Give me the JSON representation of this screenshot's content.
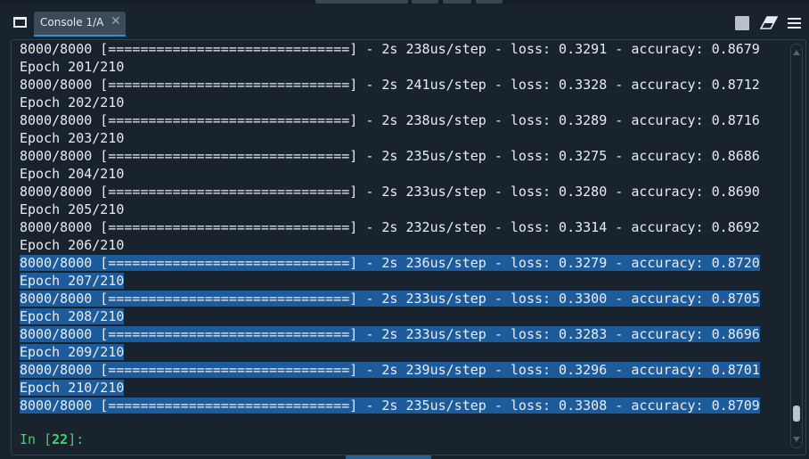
{
  "tab": {
    "label": "Console 1/A",
    "close_glyph": "✕"
  },
  "toolbar": {
    "icons": [
      "window-icon",
      "stop-icon",
      "eraser-icon",
      "hamburger-menu-icon"
    ]
  },
  "output_lines": [
    {
      "text": "8000/8000 [==============================] - 2s 238us/step - loss: 0.3291 - accuracy: 0.8679",
      "selected": false
    },
    {
      "text": "Epoch 201/210",
      "selected": false
    },
    {
      "text": "8000/8000 [==============================] - 2s 241us/step - loss: 0.3328 - accuracy: 0.8712",
      "selected": false
    },
    {
      "text": "Epoch 202/210",
      "selected": false
    },
    {
      "text": "8000/8000 [==============================] - 2s 238us/step - loss: 0.3289 - accuracy: 0.8716",
      "selected": false
    },
    {
      "text": "Epoch 203/210",
      "selected": false
    },
    {
      "text": "8000/8000 [==============================] - 2s 235us/step - loss: 0.3275 - accuracy: 0.8686",
      "selected": false
    },
    {
      "text": "Epoch 204/210",
      "selected": false
    },
    {
      "text": "8000/8000 [==============================] - 2s 233us/step - loss: 0.3280 - accuracy: 0.8690",
      "selected": false
    },
    {
      "text": "Epoch 205/210",
      "selected": false
    },
    {
      "text": "8000/8000 [==============================] - 2s 232us/step - loss: 0.3314 - accuracy: 0.8692",
      "selected": false
    },
    {
      "text": "Epoch 206/210",
      "selected": false
    },
    {
      "text": "8000/8000 [==============================] - 2s 236us/step - loss: 0.3279 - accuracy: 0.8720",
      "selected": true
    },
    {
      "text": "Epoch 207/210",
      "selected": true
    },
    {
      "text": "8000/8000 [==============================] - 2s 233us/step - loss: 0.3300 - accuracy: 0.8705",
      "selected": true
    },
    {
      "text": "Epoch 208/210",
      "selected": true
    },
    {
      "text": "8000/8000 [==============================] - 2s 233us/step - loss: 0.3283 - accuracy: 0.8696",
      "selected": true
    },
    {
      "text": "Epoch 209/210",
      "selected": true
    },
    {
      "text": "8000/8000 [==============================] - 2s 239us/step - loss: 0.3296 - accuracy: 0.8701",
      "selected": true
    },
    {
      "text": "Epoch 210/210",
      "selected": true
    },
    {
      "text": "8000/8000 [==============================] - 2s 235us/step - loss: 0.3308 - accuracy: 0.8709",
      "selected": true
    }
  ],
  "prompt": {
    "prefix": "In [",
    "number": "22",
    "suffix": "]:"
  },
  "colors": {
    "background": "#19232d",
    "selection": "#1d5b9a",
    "prompt": "#44d16b",
    "text": "#e8ecf0"
  }
}
